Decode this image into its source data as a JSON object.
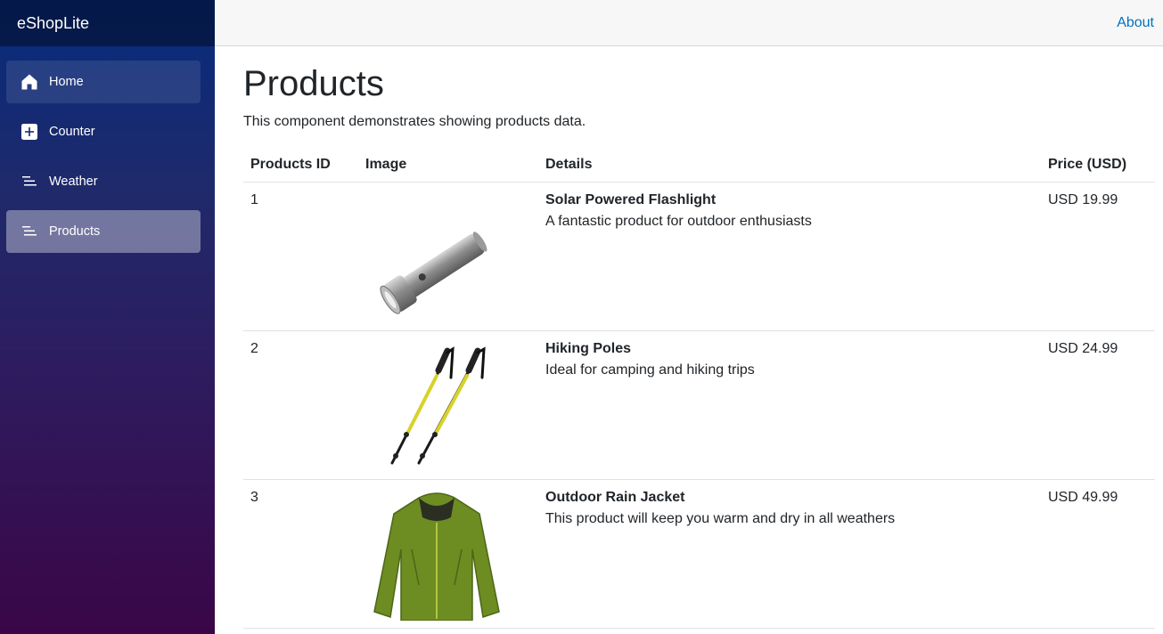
{
  "app": {
    "brand": "eShopLite"
  },
  "sidebar": {
    "items": [
      {
        "label": "Home",
        "icon": "home-icon"
      },
      {
        "label": "Counter",
        "icon": "plus-square-icon"
      },
      {
        "label": "Weather",
        "icon": "list-icon"
      },
      {
        "label": "Products",
        "icon": "list-icon",
        "active": true
      }
    ]
  },
  "top_row": {
    "about_label": "About"
  },
  "page": {
    "title": "Products",
    "description": "This component demonstrates showing products data."
  },
  "table": {
    "headers": [
      "Products ID",
      "Image",
      "Details",
      "Price (USD)"
    ],
    "rows": [
      {
        "id": "1",
        "image": "flashlight-image",
        "name": "Solar Powered Flashlight",
        "description": "A fantastic product for outdoor enthusiasts",
        "price": "USD 19.99"
      },
      {
        "id": "2",
        "image": "hiking-poles-image",
        "name": "Hiking Poles",
        "description": "Ideal for camping and hiking trips",
        "price": "USD 24.99"
      },
      {
        "id": "3",
        "image": "rain-jacket-image",
        "name": "Outdoor Rain Jacket",
        "description": "This product will keep you warm and dry in all weathers",
        "price": "USD 49.99"
      }
    ]
  },
  "colors": {
    "sidebar_top": "#062b7c",
    "sidebar_bottom": "#3a0647",
    "link": "#0071c1",
    "top_row_bg": "#f7f7f7"
  }
}
